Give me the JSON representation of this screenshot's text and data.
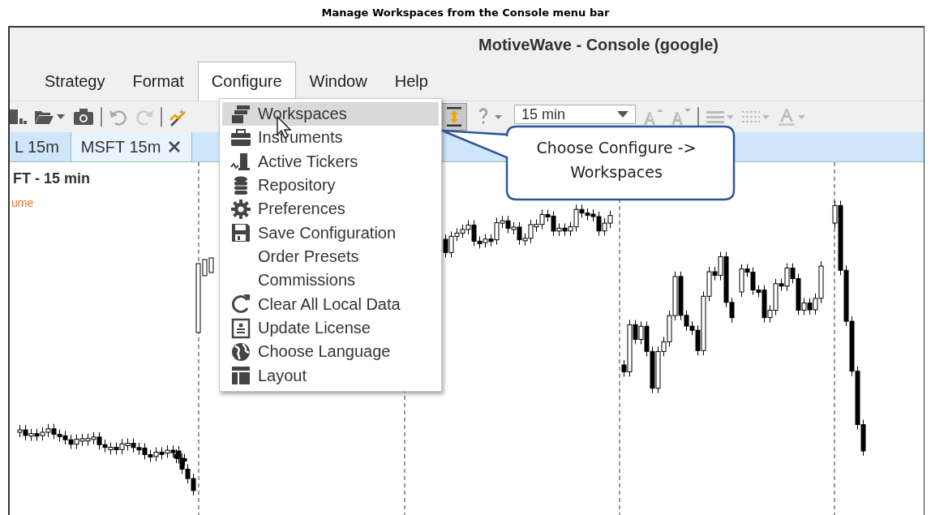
{
  "caption": "Manage Workspaces from the Console menu bar",
  "window": {
    "title": "MotiveWave - Console (google)"
  },
  "menu_bar": [
    {
      "label": "Strategy",
      "open": false
    },
    {
      "label": "Format",
      "open": false
    },
    {
      "label": "Configure",
      "open": true
    },
    {
      "label": "Window",
      "open": false
    },
    {
      "label": "Help",
      "open": false
    }
  ],
  "toolbar": {
    "timeframe": "15 min",
    "auto_scale_on": true
  },
  "tabs": [
    {
      "label": "L 15m",
      "selected": false,
      "closable": false
    },
    {
      "label": "MSFT 15m",
      "selected": true,
      "closable": true
    }
  ],
  "chart": {
    "title": "FT - 15 min",
    "legend": "ume"
  },
  "dropdown_menu": {
    "items": [
      {
        "label": "Workspaces",
        "kind": "workspaces",
        "highlighted": true
      },
      {
        "label": "Instruments",
        "kind": "briefcase",
        "highlighted": false
      },
      {
        "label": "Active Tickers",
        "kind": "tickers",
        "highlighted": false
      },
      {
        "label": "Repository",
        "kind": "database",
        "highlighted": false
      },
      {
        "label": "Preferences",
        "kind": "gear",
        "highlighted": false
      },
      {
        "label": "Save Configuration",
        "kind": "save",
        "highlighted": false
      },
      {
        "label": "Order Presets",
        "kind": "none",
        "highlighted": false
      },
      {
        "label": "Commissions",
        "kind": "none",
        "highlighted": false
      },
      {
        "label": "Clear All Local Data",
        "kind": "refresh",
        "highlighted": false
      },
      {
        "label": "Update License",
        "kind": "license",
        "highlighted": false
      },
      {
        "label": "Choose Language",
        "kind": "globe",
        "highlighted": false
      },
      {
        "label": "Layout",
        "kind": "layout",
        "highlighted": false
      }
    ]
  },
  "callout": {
    "text": "Choose Configure -> Workspaces"
  }
}
